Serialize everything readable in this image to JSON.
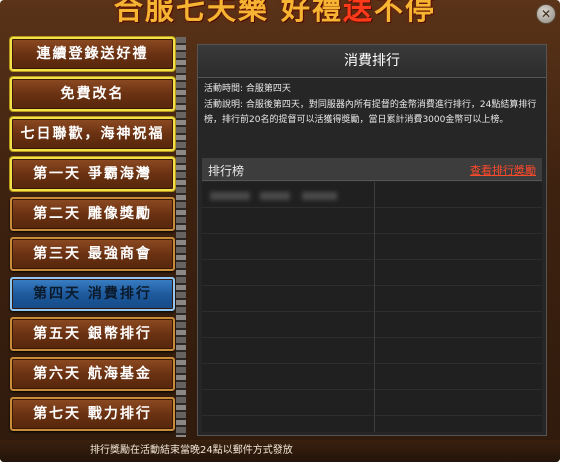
{
  "banner": {
    "part1": "合服七天樂 好禮",
    "part2": "送",
    "part3": "不停"
  },
  "close_icon": "close-icon",
  "sidebar": {
    "items": [
      {
        "label": "連續登錄送好禮"
      },
      {
        "label": "免費改名"
      },
      {
        "label": "七日聯歡，海神祝福"
      },
      {
        "label": "第一天  爭霸海灣"
      },
      {
        "label": "第二天  雕像獎勵"
      },
      {
        "label": "第三天  最強商會"
      },
      {
        "label": "第四天  消費排行"
      },
      {
        "label": "第五天  銀幣排行"
      },
      {
        "label": "第六天  航海基金"
      },
      {
        "label": "第七天  戰力排行"
      }
    ]
  },
  "panel": {
    "title": "消費排行",
    "time_line": "活動時間: 合服第四天",
    "desc_line": "活動說明: 合服後第四天，對同服器內所有提督的金幣消費進行排行，24點結算排行榜，排行前20名的提督可以活獲得獎勵，當日累計消費3000金幣可以上榜。",
    "rank_title": "排行榜",
    "rank_link": "查看排行獎勵"
  },
  "footer": {
    "text": "排行獎勵在活動結束當晚24點以郵件方式發放"
  }
}
